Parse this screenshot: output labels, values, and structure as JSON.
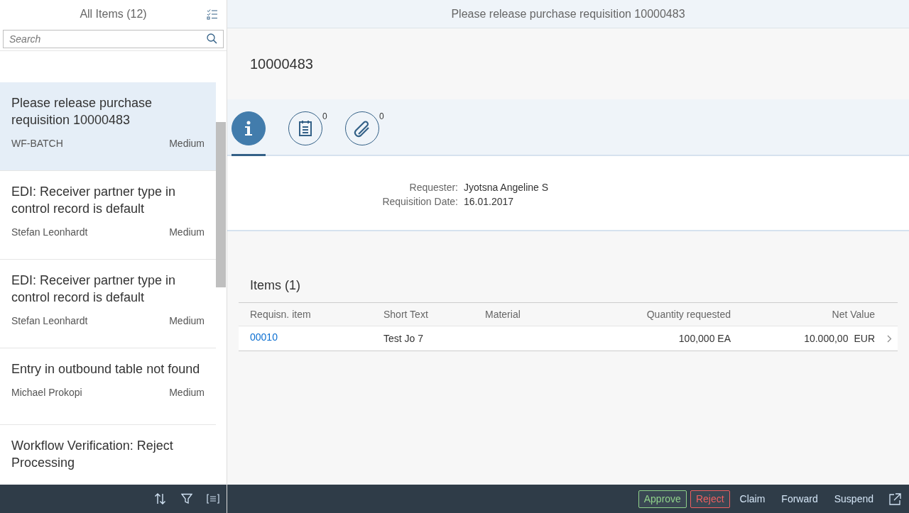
{
  "master": {
    "title": "All Items (12)",
    "search": {
      "placeholder": "Search"
    },
    "items": [
      {
        "title": "Please release purchase requisition 10000483",
        "creator": "WF-BATCH",
        "priority": "Medium",
        "selected": true
      },
      {
        "title": "EDI: Receiver partner type in control record is default",
        "creator": "Stefan Leonhardt",
        "priority": "Medium",
        "selected": false
      },
      {
        "title": "EDI: Receiver partner type in control record is default",
        "creator": "Stefan Leonhardt",
        "priority": "Medium",
        "selected": false
      },
      {
        "title": "Entry in outbound table not found",
        "creator": "Michael Prokopi",
        "priority": "Medium",
        "selected": false
      },
      {
        "title": "Workflow Verification: Reject Processing",
        "selected": false
      }
    ]
  },
  "detail": {
    "title": "Please release purchase requisition 10000483",
    "object_title": "10000483",
    "tabs": [
      {
        "kind": "info",
        "selected": true
      },
      {
        "kind": "notes",
        "count": "0",
        "selected": false
      },
      {
        "kind": "attachments",
        "count": "0",
        "selected": false
      }
    ],
    "fields": [
      {
        "label": "Requester:",
        "value": "Jyotsna Angeline S"
      },
      {
        "label": "Requisition Date:",
        "value": "16.01.2017"
      }
    ],
    "table": {
      "title": "Items (1)",
      "columns": [
        "Requisn. item",
        "Short Text",
        "Material",
        "Quantity requested",
        "Net Value"
      ],
      "rows": [
        {
          "item": "00010",
          "short_text": "Test Jo 7",
          "material": "",
          "quantity": "100,000 EA",
          "net_value": "10.000,00",
          "currency": "EUR"
        }
      ]
    }
  },
  "footer_actions": [
    {
      "label": "Approve",
      "kind": "accept"
    },
    {
      "label": "Reject",
      "kind": "reject"
    },
    {
      "label": "Claim",
      "kind": "plain"
    },
    {
      "label": "Forward",
      "kind": "plain"
    },
    {
      "label": "Suspend",
      "kind": "plain"
    }
  ]
}
